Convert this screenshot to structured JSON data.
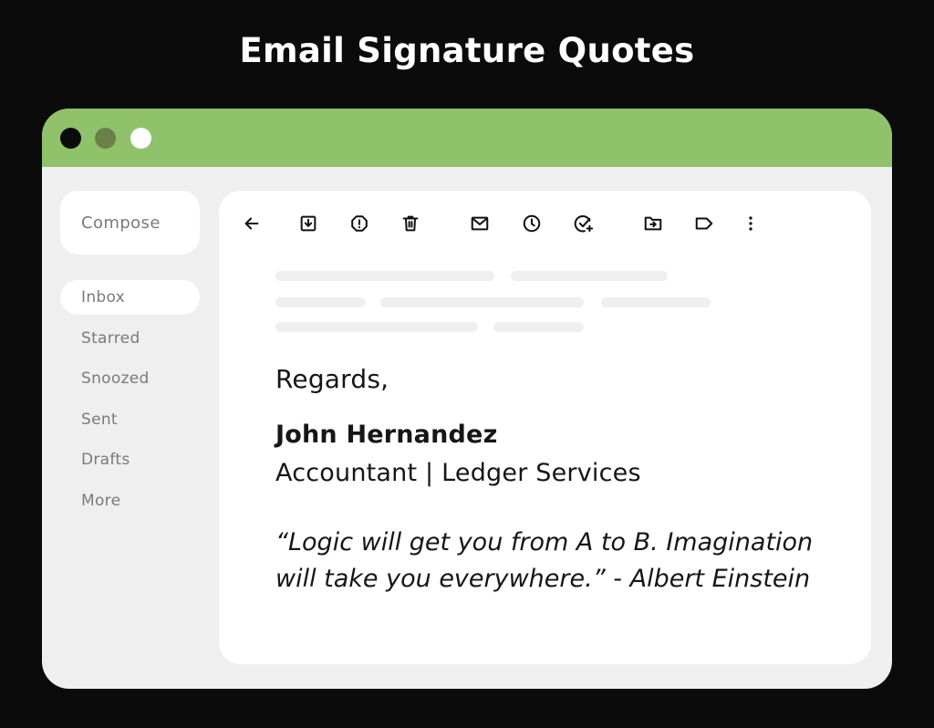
{
  "page": {
    "title": "Email Signature Quotes"
  },
  "window": {
    "titlebar_color": "#8fc26a",
    "controls": [
      {
        "name": "close",
        "color": "#0b0b0b"
      },
      {
        "name": "minimize",
        "color": "#6b8049"
      },
      {
        "name": "maximize",
        "color": "#ffffff"
      }
    ]
  },
  "sidebar": {
    "compose_label": "Compose",
    "items": [
      {
        "label": "Inbox",
        "active": true
      },
      {
        "label": "Starred",
        "active": false
      },
      {
        "label": "Snoozed",
        "active": false
      },
      {
        "label": "Sent",
        "active": false
      },
      {
        "label": "Drafts",
        "active": false
      },
      {
        "label": "More",
        "active": false
      }
    ]
  },
  "toolbar": {
    "icons": [
      "back-arrow-icon",
      "archive-icon",
      "report-spam-icon",
      "delete-icon",
      "mark-unread-icon",
      "snooze-icon",
      "add-to-tasks-icon",
      "move-to-icon",
      "label-icon",
      "more-vert-icon"
    ]
  },
  "email": {
    "closing": "Regards,",
    "signature": {
      "name": "John Hernandez",
      "role": "Accountant | Ledger Services",
      "quote_line1": "“Logic will get you from A to B. Imagination",
      "quote_line2": "will take you everywhere.” - Albert Einstein"
    }
  }
}
